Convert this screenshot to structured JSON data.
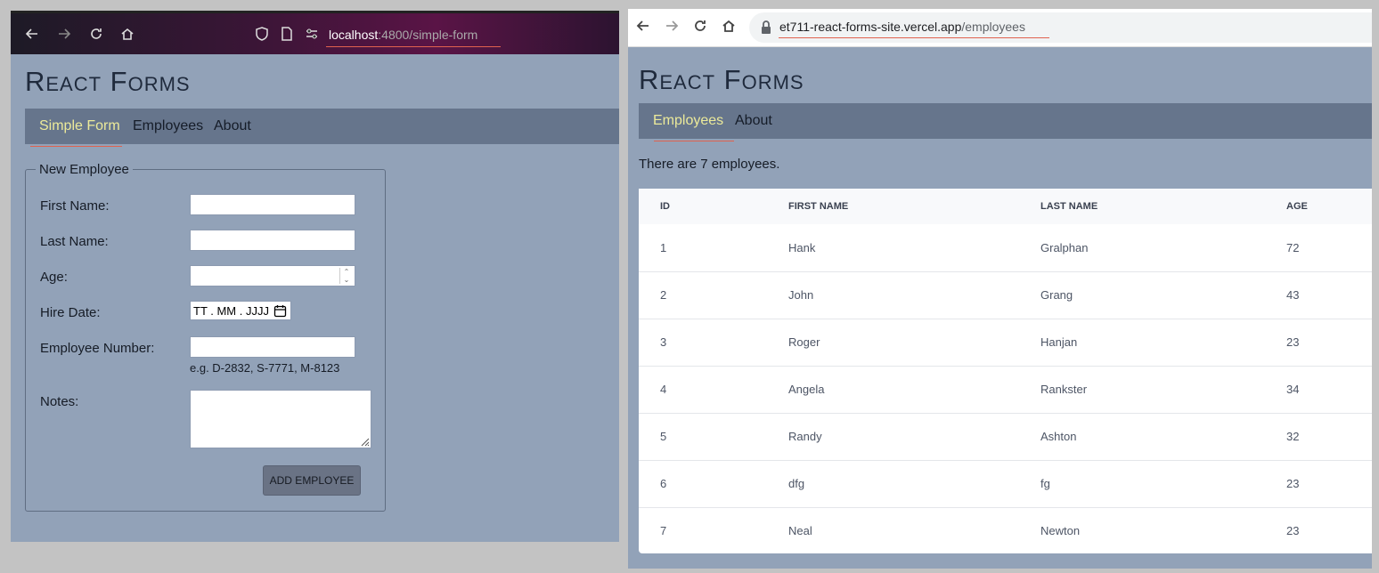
{
  "left_window": {
    "url_host": "localhost",
    "url_path": ":4800/simple-form",
    "app_title": "React Forms",
    "nav": [
      "Simple Form",
      "Employees",
      "About"
    ],
    "form": {
      "legend": "New Employee",
      "first_name_label": "First Name:",
      "last_name_label": "Last Name:",
      "age_label": "Age:",
      "hire_date_label": "Hire Date:",
      "hire_date_placeholder": "TT . MM . JJJJ",
      "employee_number_label": "Employee Number:",
      "employee_number_hint": "e.g. D-2832, S-7771, M-8123",
      "notes_label": "Notes:",
      "submit_label": "ADD EMPLOYEE"
    }
  },
  "right_window": {
    "url_host": "et711-react-forms-site.vercel.app",
    "url_path": "/employees",
    "app_title": "React Forms",
    "nav": [
      "Employees",
      "About"
    ],
    "count_text": "There are 7 employees.",
    "table": {
      "headers": [
        "ID",
        "FIRST NAME",
        "LAST NAME",
        "AGE"
      ],
      "rows": [
        [
          "1",
          "Hank",
          "Gralphan",
          "72"
        ],
        [
          "2",
          "John",
          "Grang",
          "43"
        ],
        [
          "3",
          "Roger",
          "Hanjan",
          "23"
        ],
        [
          "4",
          "Angela",
          "Rankster",
          "34"
        ],
        [
          "5",
          "Randy",
          "Ashton",
          "32"
        ],
        [
          "6",
          "dfg",
          "fg",
          "23"
        ],
        [
          "7",
          "Neal",
          "Newton",
          "23"
        ]
      ]
    }
  },
  "colors": {
    "page_bg": "#92a2b8",
    "nav_bg": "#66758c",
    "active_nav": "#ecea9a",
    "underline": "#e0624f"
  }
}
